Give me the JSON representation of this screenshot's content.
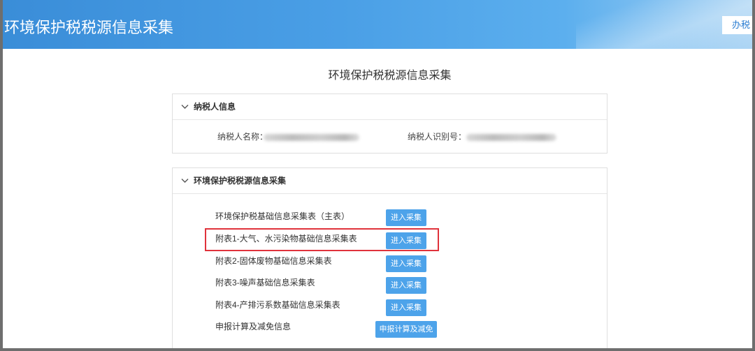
{
  "header": {
    "title": "环境保护税税源信息采集",
    "top_button_label": "办税"
  },
  "page_title": "环境保护税税源信息采集",
  "taxpayer_panel": {
    "title": "纳税人信息",
    "name_label": "纳税人名称：",
    "id_label": "纳税人识别号："
  },
  "collection_panel": {
    "title": "环境保护税税源信息采集",
    "rows": [
      {
        "label": "环境保护税基础信息采集表（主表）",
        "button": "进入采集"
      },
      {
        "label": "附表1-大气、水污染物基础信息采集表",
        "button": "进入采集"
      },
      {
        "label": "附表2-固体废物基础信息采集表",
        "button": "进入采集"
      },
      {
        "label": "附表3-噪声基础信息采集表",
        "button": "进入采集"
      },
      {
        "label": "附表4-产排污系数基础信息采集表",
        "button": "进入采集"
      },
      {
        "label": "申报计算及减免信息",
        "button": "申报计算及减免"
      }
    ]
  },
  "icons": {
    "panel_toggle": "chevron-down-icon"
  },
  "colors": {
    "header_blue": "#4a9fe6",
    "button_blue": "#4da3ea",
    "highlight_red": "#e0323b",
    "text": "#333333"
  }
}
